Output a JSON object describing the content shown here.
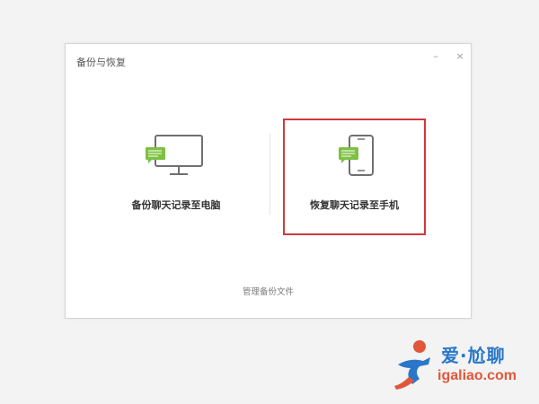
{
  "dialog": {
    "title": "备份与恢复",
    "minimize_glyph": "–",
    "close_glyph": "×"
  },
  "options": {
    "backup_to_pc": {
      "label": "备份聊天记录至电脑",
      "icon": "computer-chat-icon"
    },
    "restore_to_phone": {
      "label": "恢复聊天记录至手机",
      "icon": "phone-chat-icon",
      "highlight_color": "#d0383e"
    }
  },
  "manage_link": "管理备份文件",
  "watermark": {
    "cn_text": "爱·尬聊",
    "en_text": "igaliao.com",
    "colors": {
      "blue": "#2a77c9",
      "orange": "#e2573a"
    }
  },
  "colors": {
    "accent_green": "#7dc142",
    "icon_gray": "#707070"
  }
}
